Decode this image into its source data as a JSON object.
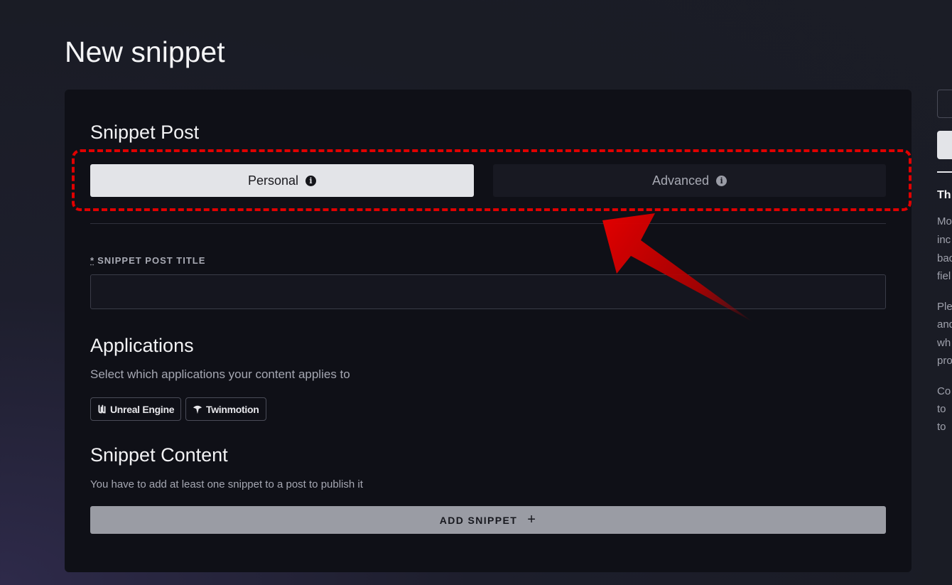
{
  "page": {
    "title": "New snippet"
  },
  "snippet_post": {
    "heading": "Snippet Post",
    "toggle": {
      "personal_label": "Personal",
      "advanced_label": "Advanced",
      "selected": "Personal"
    }
  },
  "title_field": {
    "required_marker": "*",
    "label": "SNIPPET POST TITLE",
    "value": "",
    "placeholder": ""
  },
  "applications": {
    "heading": "Applications",
    "description": "Select which applications your content applies to",
    "chips": [
      "Unreal Engine",
      "Twinmotion"
    ]
  },
  "snippet_content": {
    "heading": "Snippet Content",
    "description": "You have to add at least one snippet to a post to publish it",
    "add_button_label": "ADD SNIPPET",
    "add_button_icon": "+"
  },
  "side_panel": {
    "heading": "Th",
    "lines": [
      "Mo",
      "inc",
      "bac",
      "fiel",
      "Ple",
      "and",
      "wh",
      "pro",
      "Co",
      "to",
      "to"
    ]
  },
  "colors": {
    "highlight": "#e00000",
    "arrow": "#d40000",
    "card_bg": "#0f1017",
    "selected_toggle_bg": "#e3e4e8"
  }
}
